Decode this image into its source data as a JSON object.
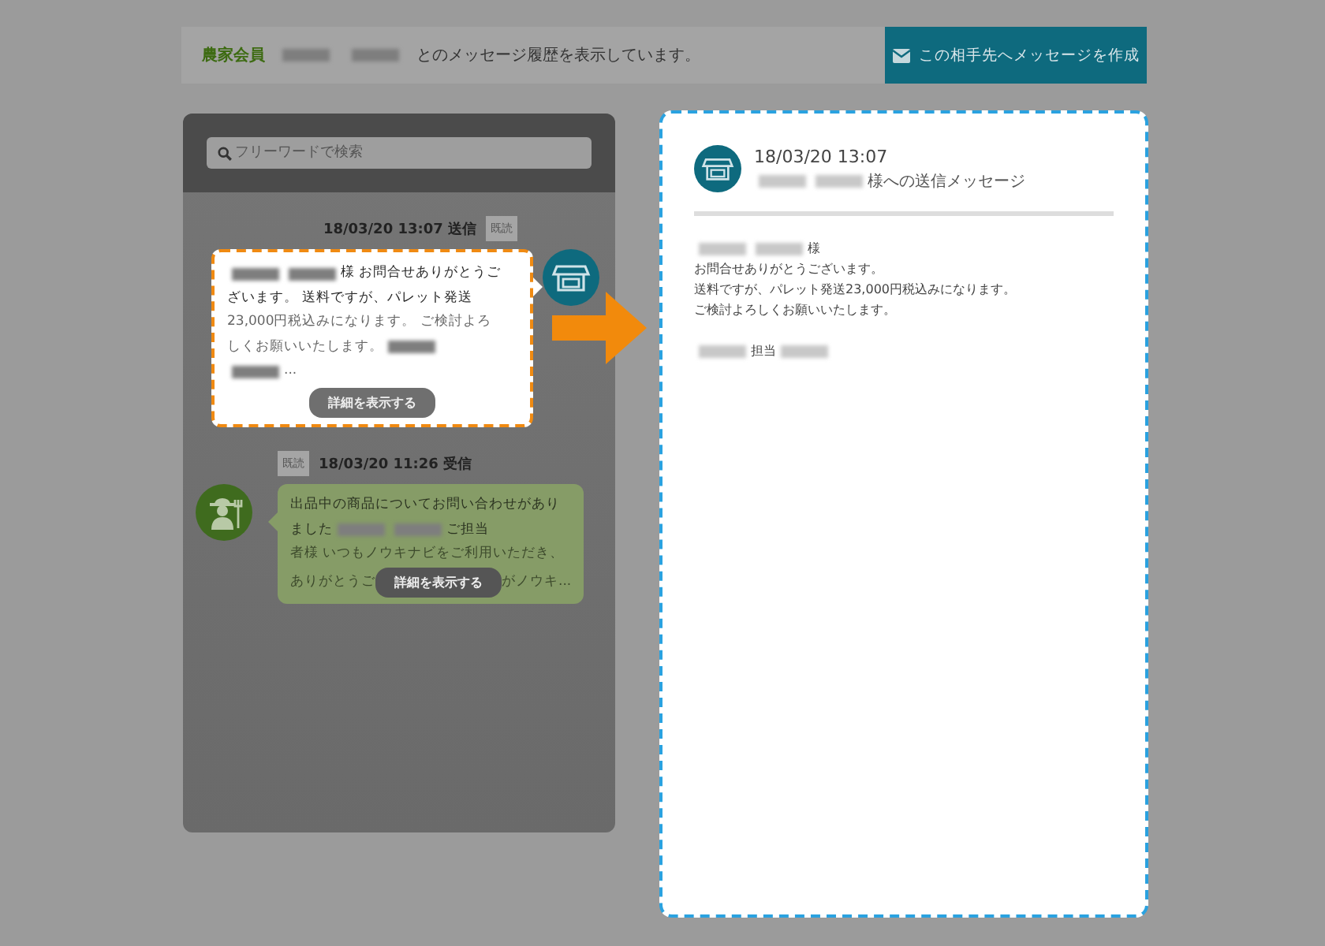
{
  "header": {
    "parts": [
      {
        "kind": "label",
        "text": "農家会員"
      },
      {
        "kind": "redacted"
      },
      {
        "kind": "redacted"
      },
      {
        "kind": "text",
        "text": "とのメッセージ履歴を表示しています。"
      }
    ],
    "compose_button": "この相手先へメッセージを作成"
  },
  "search": {
    "placeholder": "フリーワードで検索"
  },
  "messages": [
    {
      "kind": "sent",
      "timestamp": "18/03/20 13:07 送信",
      "read_badge": "既読",
      "highlighted": true,
      "lines": [
        [
          {
            "kind": "redacted"
          },
          {
            "kind": "redacted"
          },
          {
            "kind": "text",
            "text": "様 お問合せありがとうご"
          }
        ],
        [
          {
            "kind": "text",
            "text": "ざいます。 送料ですが、パレット発送"
          }
        ],
        [
          {
            "kind": "text",
            "text": "23,000円税込みになります。 ご検討よろ"
          }
        ],
        [
          {
            "kind": "text",
            "text": "しくお願いいたします。"
          },
          {
            "kind": "redacted"
          }
        ],
        [
          {
            "kind": "redacted"
          },
          {
            "kind": "text",
            "text": "..."
          }
        ]
      ],
      "detail_button": "詳細を表示する"
    },
    {
      "kind": "received",
      "timestamp": "18/03/20 11:26 受信",
      "read_badge": "既読",
      "highlighted": false,
      "lines": [
        [
          {
            "kind": "text",
            "text": "出品中の商品についてお問い合わせがあり"
          }
        ],
        [
          {
            "kind": "text",
            "text": "ました"
          },
          {
            "kind": "redacted"
          },
          {
            "kind": "redacted"
          },
          {
            "kind": "text",
            "text": "ご担当"
          }
        ],
        [
          {
            "kind": "text",
            "text": "者様 いつもノウキナビをご利用いただき、"
          }
        ]
      ],
      "last_line": {
        "left": "ありがとうご",
        "right": "がノウキ..."
      },
      "detail_button": "詳細を表示する"
    }
  ],
  "detail": {
    "datetime": "18/03/20 13:07",
    "subject": [
      {
        "kind": "redacted"
      },
      {
        "kind": "redacted"
      },
      {
        "kind": "text",
        "text": "様への送信メッセージ"
      }
    ],
    "paragraphs": [
      [
        [
          {
            "kind": "redacted"
          },
          {
            "kind": "redacted"
          },
          {
            "kind": "text",
            "text": "様"
          }
        ],
        [
          {
            "kind": "text",
            "text": "お問合せありがとうございます。"
          }
        ],
        [
          {
            "kind": "text",
            "text": "送料ですが、パレット発送23,000円税込みになります。"
          }
        ],
        [
          {
            "kind": "text",
            "text": "ご検討よろしくお願いいたします。"
          }
        ]
      ],
      [
        [
          {
            "kind": "redacted"
          },
          {
            "kind": "text",
            "text": "担当"
          },
          {
            "kind": "redacted"
          }
        ]
      ]
    ]
  }
}
